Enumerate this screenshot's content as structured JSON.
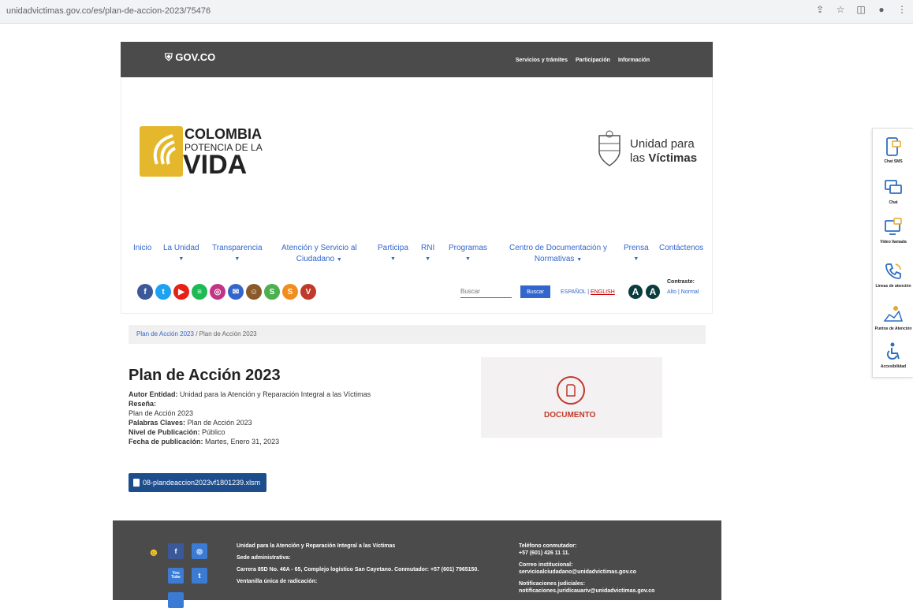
{
  "browser": {
    "url": "unidadvictimas.gov.co/es/plan-de-accion-2023/75476",
    "icons": [
      "share-icon",
      "star-icon",
      "sidepanel-icon",
      "profile-icon",
      "menu-icon"
    ]
  },
  "govbar": {
    "logo": "GOV.CO",
    "links": [
      "Servicios y trámites",
      "Participación",
      "Información"
    ]
  },
  "logo_left": {
    "line1": "COLOMBIA",
    "line2": "POTENCIA DE LA",
    "line3": "VIDA"
  },
  "logo_right": {
    "line1": "Unidad para",
    "line2_prefix": "las ",
    "line2_bold": "Víctimas"
  },
  "nav": {
    "items": [
      {
        "label": "Inicio"
      },
      {
        "label": "La Unidad"
      },
      {
        "label": "Transparencia"
      },
      {
        "label": "Atención y Servicio al"
      },
      {
        "label": "Ciudadano"
      },
      {
        "label": "Participa"
      },
      {
        "label": "RNI"
      },
      {
        "label": "Programas"
      },
      {
        "label": "Centro de Documentación y"
      },
      {
        "label": "Normativas"
      },
      {
        "label": "Prensa"
      },
      {
        "label": "Contáctenos"
      }
    ]
  },
  "social": [
    {
      "name": "facebook",
      "glyph": "f",
      "color": "#3b5998"
    },
    {
      "name": "twitter",
      "glyph": "t",
      "color": "#1da1f2"
    },
    {
      "name": "youtube",
      "glyph": "▶",
      "color": "#e62117"
    },
    {
      "name": "spotify",
      "glyph": "≡",
      "color": "#1db954"
    },
    {
      "name": "instagram",
      "glyph": "◎",
      "color": "#c13584"
    },
    {
      "name": "email",
      "glyph": "✉",
      "color": "#3366cc"
    },
    {
      "name": "mascot",
      "glyph": "☺",
      "color": "#8b5a2b"
    },
    {
      "name": "s-green",
      "glyph": "S",
      "color": "#4caf50"
    },
    {
      "name": "s-orange",
      "glyph": "S",
      "color": "#f28c1e"
    },
    {
      "name": "v-red",
      "glyph": "V",
      "color": "#c0392b"
    }
  ],
  "search": {
    "placeholder": "Buscar",
    "button": "Buscar"
  },
  "languages": {
    "es": "ESPAÑOL",
    "separator": "|",
    "en": "ENGLISH"
  },
  "contrast": {
    "label": "Contraste:",
    "high": "Alto",
    "sep": "|",
    "normal": "Normal",
    "a1": "A",
    "a2": "A"
  },
  "breadcrumb": {
    "link": "Plan de Acción 2023",
    "sep": "/",
    "current": "Plan de Acción 2023"
  },
  "content": {
    "title": "Plan de Acción 2023",
    "autor_label": "Autor Entidad:",
    "autor_value": "Unidad para la Atención y Reparación Integral a las Víctimas",
    "resena_label": "Reseña:",
    "resena_value": "Plan de Acción 2023",
    "palabras_label": "Palabras Claves:",
    "palabras_value": "Plan de Acción 2023",
    "nivel_label": "Nivel de Publicación:",
    "nivel_value": "Público",
    "fecha_label": "Fecha de publicación:",
    "fecha_value": "Martes, Enero 31, 2023",
    "download": "08-plandeaccion2023vf1801239.xlsm"
  },
  "document": {
    "label": "DOCUMENTO"
  },
  "footer": {
    "entity": "Unidad para la Atención y Reparación Integral a las Víctimas",
    "sede": "Sede administrativa:",
    "address": "Carrera 85D No. 46A - 65, Complejo logístico San Cayetano. Conmutador: +57 (601) 7965150.",
    "ventanilla": "Ventanilla única de radicación:",
    "tel_label": "Teléfono conmutador:",
    "tel_value": "+57 (601) 426 11 11.",
    "correo_label": "Correo institucional:",
    "correo_value": "servicioalciudadano@unidadvictimas.gov.co",
    "notif_label": "Notificaciones judiciales:",
    "notif_value": "notificaciones.juridicauariv@unidadvictimas.gov.co",
    "social": [
      {
        "name": "facebook",
        "glyph": "f",
        "bg": "#3b5998"
      },
      {
        "name": "instagram",
        "glyph": "◎",
        "bg": "#3b7bd4"
      },
      {
        "name": "youtube",
        "glyph": "You Tube",
        "bg": "#3b7bd4"
      },
      {
        "name": "twitter",
        "glyph": "t",
        "bg": "#3b7bd4"
      }
    ]
  },
  "right_panel": {
    "items": [
      {
        "label": "Chat SMS",
        "icon": "chat-sms-icon"
      },
      {
        "label": "Chat",
        "icon": "chat-icon"
      },
      {
        "label": "Video llamada",
        "icon": "video-call-icon"
      },
      {
        "label": "Líneas de atención",
        "icon": "phone-icon"
      },
      {
        "label": "Puntos de Atención",
        "icon": "map-pin-icon"
      },
      {
        "label": "Accesibilidad",
        "icon": "accessibility-icon"
      }
    ]
  }
}
